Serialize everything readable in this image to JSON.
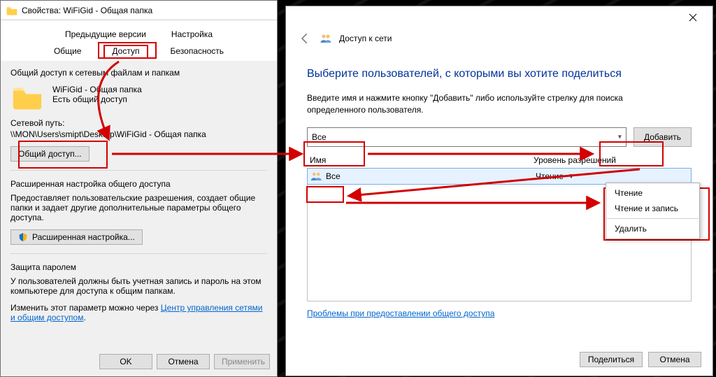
{
  "props": {
    "title": "Свойства: WiFiGid - Общая папка",
    "tabs_row1": [
      "Предыдущие версии",
      "Настройка"
    ],
    "tabs_row2": [
      "Общие",
      "Доступ",
      "Безопасность"
    ],
    "share_section_label": "Общий доступ к сетевым файлам и папкам",
    "folder_name": "WiFiGid - Общая папка",
    "share_status": "Есть общий доступ",
    "netpath_label": "Сетевой путь:",
    "netpath_value": "\\\\MON\\Users\\smipt\\Desktop\\WiFiGid - Общая папка",
    "share_button": "Общий доступ...",
    "advanced_label": "Расширенная настройка общего доступа",
    "advanced_desc": "Предоставляет пользовательские разрешения, создает общие папки и задает другие дополнительные параметры общего доступа.",
    "advanced_button": "Расширенная настройка...",
    "password_label": "Защита паролем",
    "password_desc": "У пользователей должны быть учетная запись и пароль на этом компьютере для доступа к общим папкам.",
    "password_change_pre": "Изменить этот параметр можно через ",
    "password_change_link": "Центр управления сетями и общим доступом",
    "buttons": {
      "ok": "OK",
      "cancel": "Отмена",
      "apply": "Применить"
    }
  },
  "net": {
    "nav_title": "Доступ к сети",
    "heading": "Выберите пользователей, с которыми вы хотите поделиться",
    "instr1": "Введите имя и нажмите кнопку \"Добавить\" либо используйте стрелку для поиска",
    "instr2": "определенного пользователя.",
    "combo_value": "Все",
    "add_button": "Добавить",
    "col_name": "Имя",
    "col_level": "Уровень разрешений",
    "row_name": "Все",
    "row_level": "Чтение",
    "perm_menu": {
      "read": "Чтение",
      "readwrite": "Чтение и запись",
      "remove": "Удалить"
    },
    "problems_link": "Проблемы при предоставлении общего доступа",
    "buttons": {
      "share": "Поделиться",
      "cancel": "Отмена"
    }
  }
}
